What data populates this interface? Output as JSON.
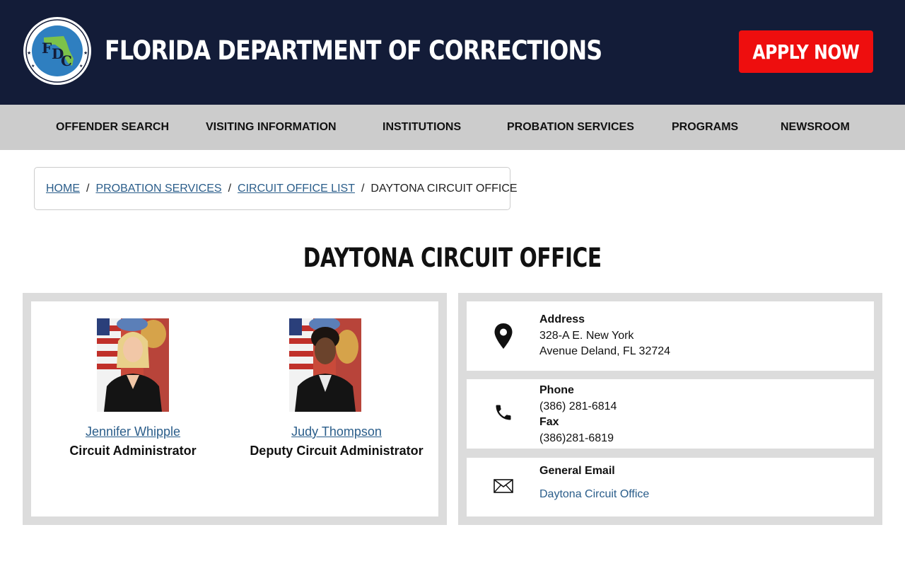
{
  "header": {
    "logo_icon": "fdc-seal-icon",
    "title": "FLORIDA DEPARTMENT OF CORRECTIONS",
    "apply_label": "APPLY NOW",
    "colors": {
      "background": "#131c38",
      "apply": "#ee0e0e"
    }
  },
  "nav": {
    "items": [
      {
        "label": "OFFENDER SEARCH"
      },
      {
        "label": "VISITING INFORMATION"
      },
      {
        "label": "INSTITUTIONS"
      },
      {
        "label": "PROBATION SERVICES"
      },
      {
        "label": "PROGRAMS"
      },
      {
        "label": "NEWSROOM"
      }
    ]
  },
  "breadcrumb": {
    "links": [
      {
        "label": "HOME"
      },
      {
        "label": "PROBATION SERVICES"
      },
      {
        "label": "CIRCUIT OFFICE LIST"
      }
    ],
    "current": "DAYTONA CIRCUIT OFFICE",
    "separator": "/"
  },
  "page": {
    "title": "DAYTONA CIRCUIT OFFICE"
  },
  "staff": [
    {
      "name": "Jennifer Whipple",
      "title": "Circuit Administrator"
    },
    {
      "name": "Judy Thompson",
      "title": "Deputy Circuit Administrator"
    }
  ],
  "contact": {
    "address": {
      "icon": "map-pin-icon",
      "label": "Address",
      "line1": "328-A E. New York",
      "line2": "Avenue Deland, FL 32724"
    },
    "phone": {
      "icon": "phone-icon",
      "phone_label": "Phone",
      "phone_value": "(386) 281-6814",
      "fax_label": "Fax",
      "fax_value": "(386)281-6819"
    },
    "email": {
      "icon": "envelope-icon",
      "label": "General Email",
      "link": "Daytona Circuit Office"
    }
  },
  "colors": {
    "link": "#2a5d8a",
    "nav_bg": "#cccccc",
    "card_border": "#dcdcdc"
  }
}
